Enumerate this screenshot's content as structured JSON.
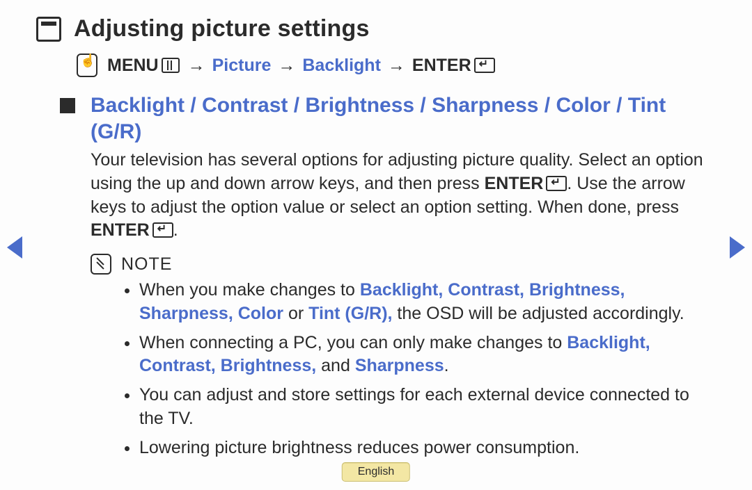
{
  "title": "Adjusting picture settings",
  "breadcrumb": {
    "menu_label": "MENU",
    "picture": "Picture",
    "backlight": "Backlight",
    "enter_label": "ENTER"
  },
  "section": {
    "heading": "Backlight / Contrast / Brightness / Sharpness / Color / Tint (G/R)",
    "para_pre": "Your television has several options for adjusting picture quality. Select an option using the up and down arrow keys, and then press ",
    "enter1": "ENTER",
    "para_mid": ". Use the arrow keys to adjust the option value or select an option setting. When done, press ",
    "enter2": "ENTER",
    "para_end": "."
  },
  "note_label": "NOTE",
  "notes": {
    "n1a": "When you make changes to ",
    "n1b": "Backlight, Contrast, Brightness, Sharpness, Color",
    "n1c": " or ",
    "n1d": "Tint (G/R),",
    "n1e": " the OSD will be adjusted accordingly.",
    "n2a": "When connecting a PC, you can only make changes to ",
    "n2b": "Backlight, Contrast, Brightness,",
    "n2c": " and ",
    "n2d": "Sharpness",
    "n2e": ".",
    "n3": "You can adjust and store settings for each external device connected to the TV.",
    "n4": "Lowering picture brightness reduces power consumption."
  },
  "language_button": "English"
}
